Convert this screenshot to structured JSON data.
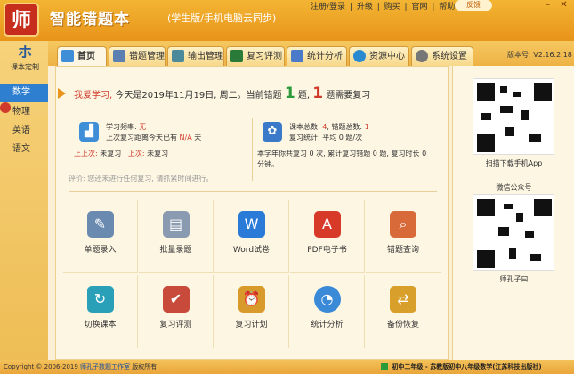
{
  "app": {
    "logo_glyph": "师",
    "title": "智能错题本",
    "subtitle": "(学生版/手机电脑云同步)"
  },
  "topmenu": {
    "items": [
      "注册/登录",
      "升级",
      "购买",
      "官网",
      "帮助"
    ],
    "separator": "|",
    "feedback": "反馈",
    "min": "–",
    "close": "✕"
  },
  "sidebar": {
    "custom_label": "课本定制",
    "custom_glyph": "ホ",
    "subjects": [
      "数学",
      "物理",
      "英语",
      "语文"
    ],
    "active_subject": "数学"
  },
  "tabs": [
    {
      "label": "首页",
      "color": "#3e8fd8"
    },
    {
      "label": "错题管理",
      "color": "#5a7fb0"
    },
    {
      "label": "输出管理",
      "color": "#4a8a9a"
    },
    {
      "label": "复习评测",
      "color": "#2a7a3a"
    },
    {
      "label": "统计分析",
      "color": "#4a7ac8"
    },
    {
      "label": "资源中心",
      "color": "#2a8ad0"
    },
    {
      "label": "系统设置",
      "color": "#777777"
    }
  ],
  "version": "版本号: V2.16.2.18",
  "home": {
    "greet_hi": "我爱学习,",
    "greet_text": "今天是2019年11月19日, 周二。当前错题",
    "wrong_count": "1",
    "greet_mid": "题,",
    "review_count": "1",
    "greet_end": "题需要复习",
    "study": {
      "freq_label": "学习频率:",
      "freq_value": "无",
      "last_interval_label": "上次复习距离今天已有",
      "last_interval_value": "N/A",
      "last_interval_unit": "天",
      "last_up_label": "上上次:",
      "last_up_value": "未复习",
      "last_label": "上次:",
      "last_value": "未复习"
    },
    "totals": {
      "total_label": "课本总数:",
      "total_value": "4",
      "wrong_label": "错题总数:",
      "wrong_value": "1",
      "stats_label": "复习统计:",
      "stats_value": "平均 0 题/次",
      "week_text": "本学年你共复习 0 次, 累计复习错题 0 题, 复习时长 0 分钟。"
    },
    "tip": "评价: 您还未进行任何复习, 请抓紧时间进行。",
    "actions": [
      {
        "label": "单题录入",
        "glyph": "✎",
        "color": "#6a8ab0"
      },
      {
        "label": "批量录题",
        "glyph": "▤",
        "color": "#8a9ab0"
      },
      {
        "label": "Word试卷",
        "glyph": "W",
        "color": "#2a7ad8"
      },
      {
        "label": "PDF电子书",
        "glyph": "A",
        "color": "#d83a2a"
      },
      {
        "label": "错题查询",
        "glyph": "⌕",
        "color": "#d86a3a"
      },
      {
        "label": "切换课本",
        "glyph": "↻",
        "color": "#2aa0b8"
      },
      {
        "label": "复习评测",
        "glyph": "✔",
        "color": "#c84a3a"
      },
      {
        "label": "复习计划",
        "glyph": "⏰",
        "color": "#d89a2a"
      },
      {
        "label": "统计分析",
        "glyph": "◔",
        "color": "#3a8ad8"
      },
      {
        "label": "备份恢复",
        "glyph": "⇄",
        "color": "#d8a02a"
      }
    ]
  },
  "right": {
    "app_caption": "扫描下载手机App",
    "wechat_title": "微信公众号",
    "wechat_name": "师孔子曰"
  },
  "footer": {
    "copyright": "Copyright © 2006-2019",
    "studio": "师孔子数题工作室",
    "rights": "版权所有",
    "status": "初中二年级 - 苏教版初中八年级数学(江苏科技出版社)"
  }
}
